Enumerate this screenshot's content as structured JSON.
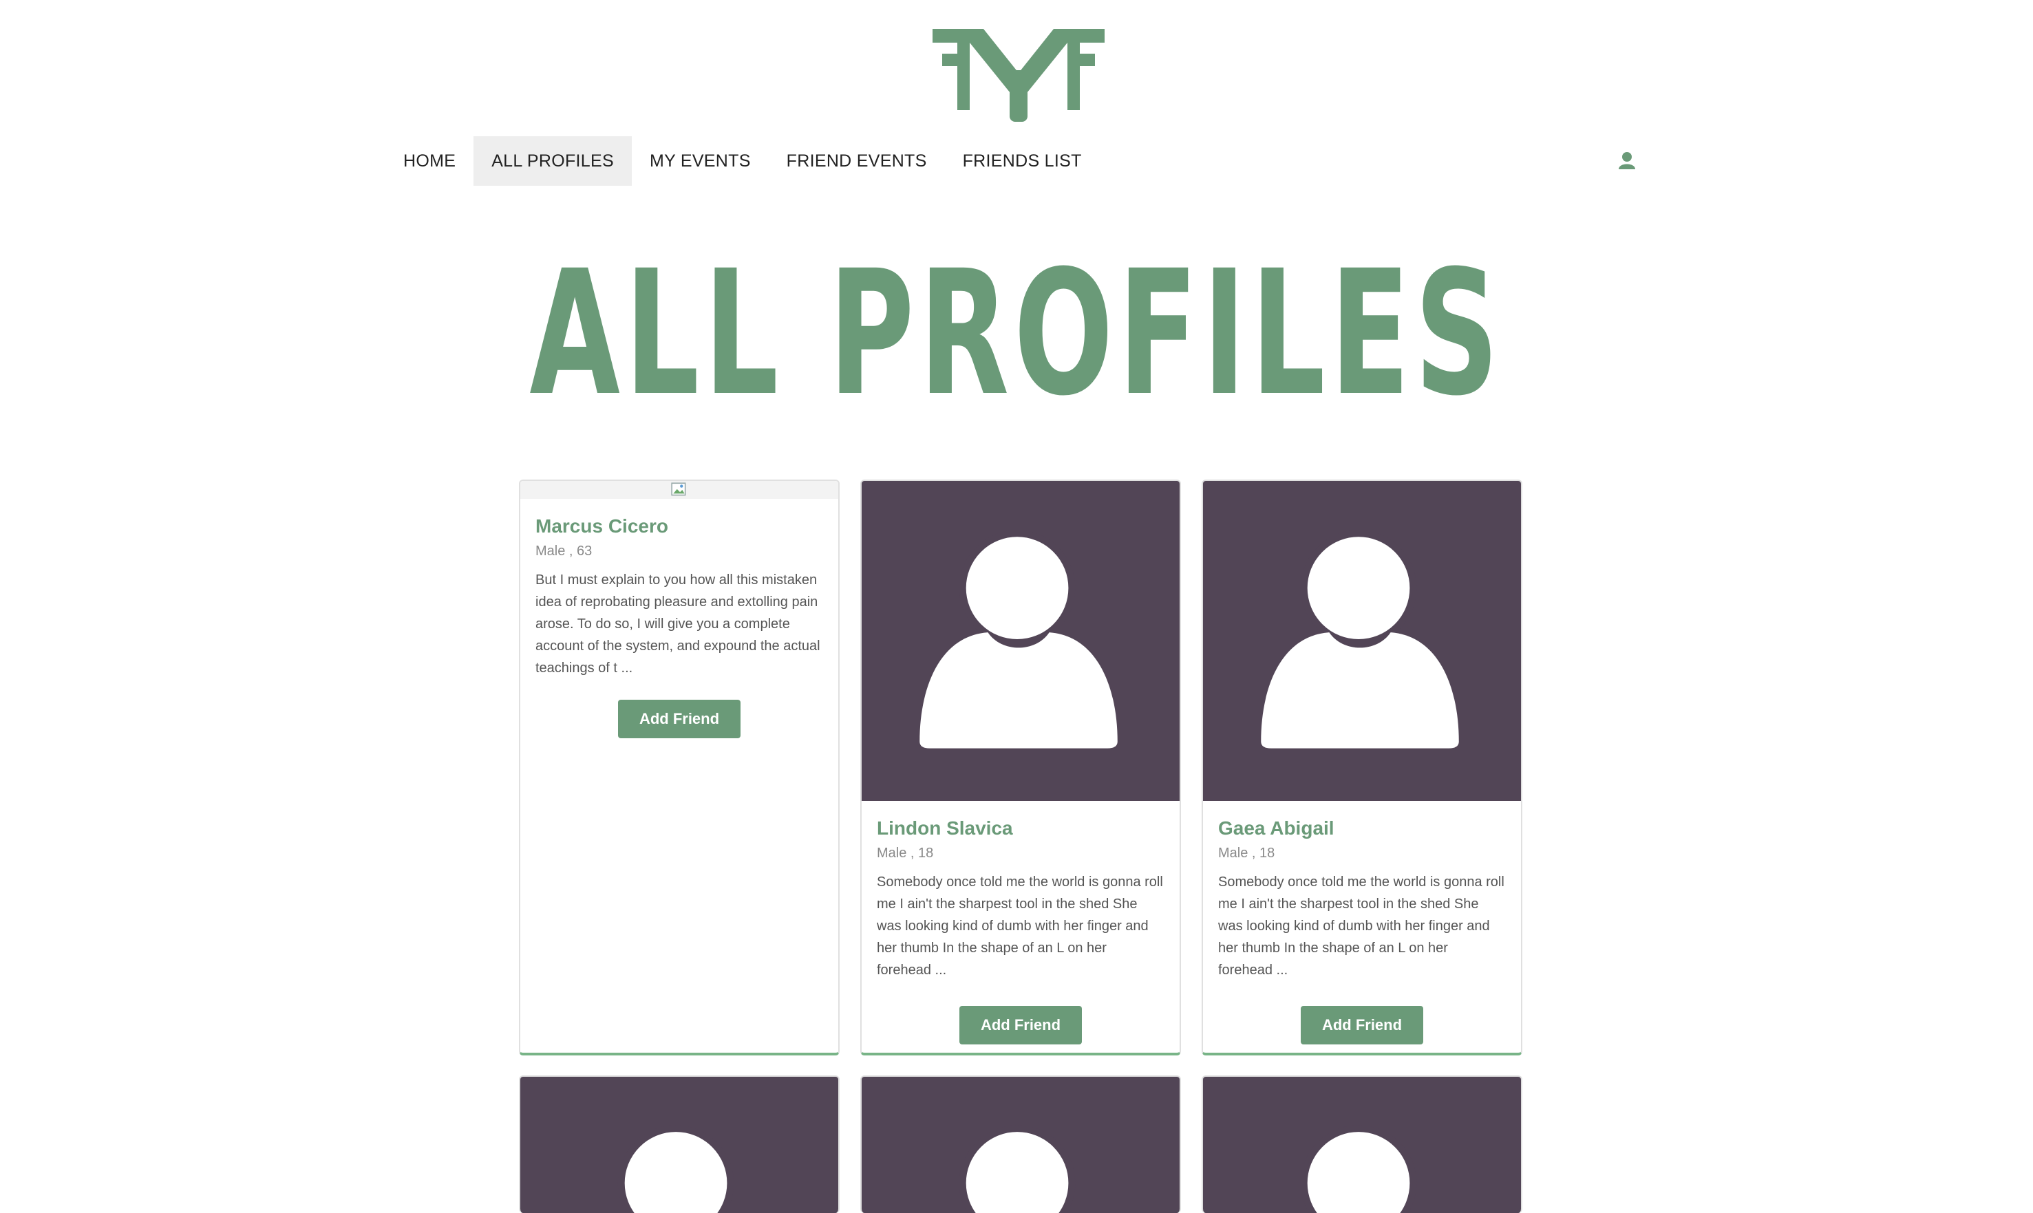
{
  "brand": {
    "logo_text": "FMF",
    "color": "#6a9a78"
  },
  "nav": {
    "items": [
      {
        "label": "HOME"
      },
      {
        "label": "ALL PROFILES"
      },
      {
        "label": "MY EVENTS"
      },
      {
        "label": "FRIEND EVENTS"
      },
      {
        "label": "FRIENDS LIST"
      }
    ],
    "active_index": 1,
    "user_icon": "user-icon"
  },
  "page": {
    "title": "ALL PROFILES"
  },
  "profiles": [
    {
      "name": "Marcus Cicero",
      "meta": "Male , 63",
      "description": "But I must explain to you how all this mistaken idea of reprobating pleasure and extolling pain arose. To do so, I will give you a complete account of the system, and expound the actual teachings of t ...",
      "image": "broken-image-icon",
      "button": "Add Friend"
    },
    {
      "name": "Lindon Slavica",
      "meta": "Male , 18",
      "description": "Somebody once told me the world is gonna roll me I ain't the sharpest tool in the shed She was looking kind of dumb with her finger and her thumb In the shape of an L on her forehead ...",
      "image": "default-avatar-icon",
      "button": "Add Friend"
    },
    {
      "name": "Gaea Abigail",
      "meta": "Male , 18",
      "description": "Somebody once told me the world is gonna roll me I ain't the sharpest tool in the shed She was looking kind of dumb with her finger and her thumb In the shape of an L on her forehead ...",
      "image": "default-avatar-icon",
      "button": "Add Friend"
    }
  ],
  "colors": {
    "accent": "#6a9a78",
    "avatar_bg": "#524556",
    "card_border": "#78b487"
  }
}
